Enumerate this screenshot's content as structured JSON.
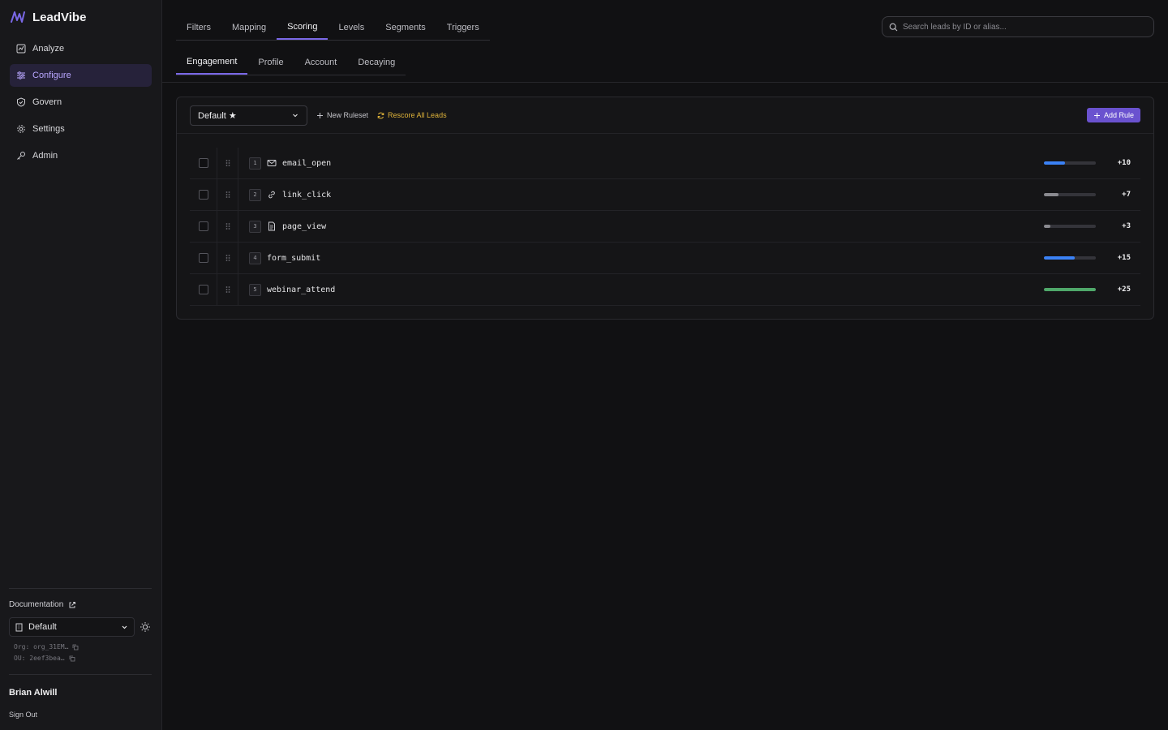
{
  "brand": {
    "name": "LeadVibe",
    "accent": "#7a68e6"
  },
  "sidebar": {
    "items": [
      {
        "label": "Analyze",
        "icon": "analytics-icon",
        "active": false
      },
      {
        "label": "Configure",
        "icon": "sliders-icon",
        "active": true
      },
      {
        "label": "Govern",
        "icon": "shield-icon",
        "active": false
      },
      {
        "label": "Settings",
        "icon": "gear-icon",
        "active": false
      },
      {
        "label": "Admin",
        "icon": "key-icon",
        "active": false
      }
    ],
    "documentation_label": "Documentation",
    "ou_select_value": "Default",
    "org_label": "Org: org_31EM…",
    "ou_label": "OU: 2eef3bea…",
    "user_name": "Brian Alwill",
    "sign_out": "Sign Out"
  },
  "tabs": {
    "primary": [
      "Filters",
      "Mapping",
      "Scoring",
      "Levels",
      "Segments",
      "Triggers"
    ],
    "primary_active": "Scoring",
    "secondary": [
      "Engagement",
      "Profile",
      "Account",
      "Decaying"
    ],
    "secondary_active": "Engagement"
  },
  "search": {
    "placeholder": "Search leads by ID or alias..."
  },
  "panel": {
    "ruleset_value": "Default ★",
    "new_ruleset": "New Ruleset",
    "rescore": "Rescore All Leads",
    "add_rule": "Add Rule",
    "rules": [
      {
        "index": "1",
        "name": "email_open",
        "icon": "mail-icon",
        "points": "+10",
        "fraction": 0.4,
        "color": "#3b82f6"
      },
      {
        "index": "2",
        "name": "link_click",
        "icon": "link-icon",
        "points": "+7",
        "fraction": 0.28,
        "color": "#8a8a90"
      },
      {
        "index": "3",
        "name": "page_view",
        "icon": "file-icon",
        "points": "+3",
        "fraction": 0.12,
        "color": "#8a8a90"
      },
      {
        "index": "4",
        "name": "form_submit",
        "icon": "",
        "points": "+15",
        "fraction": 0.6,
        "color": "#3b82f6"
      },
      {
        "index": "5",
        "name": "webinar_attend",
        "icon": "",
        "points": "+25",
        "fraction": 1.0,
        "color": "#4fa86a"
      }
    ]
  }
}
